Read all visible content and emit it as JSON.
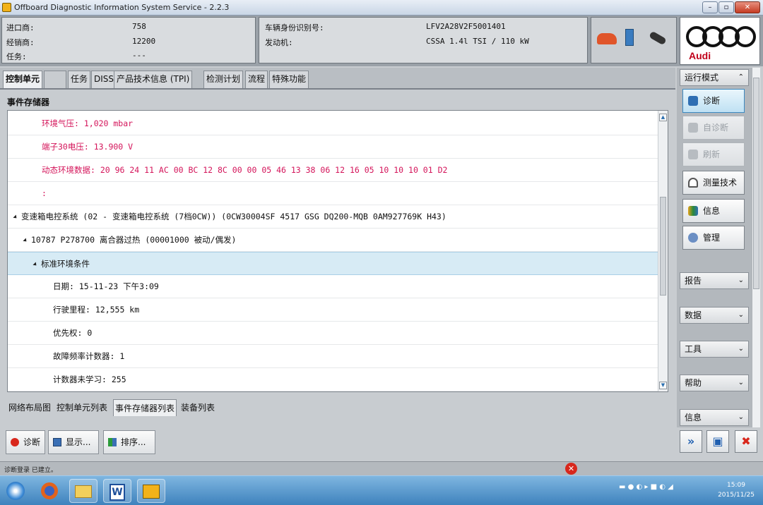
{
  "window": {
    "title": "Offboard Diagnostic Information System Service - 2.2.3"
  },
  "header": {
    "importer_label": "进口商:",
    "importer_value": "758",
    "dealer_label": "经销商:",
    "dealer_value": "12200",
    "task_label": "任务:",
    "task_value": "---",
    "vin_label": "车辆身份识别号:",
    "vin_value": "LFV2A28V2F5001401",
    "engine_label": "发动机:",
    "engine_value": "CSSA 1.4l TSI / 110 kW",
    "brand": "Audi"
  },
  "tabs": [
    {
      "label": "控制单元"
    },
    {
      "label": "   "
    },
    {
      "label": "任务"
    },
    {
      "label": "DISS"
    },
    {
      "label": "产品技术信息 (TPI)"
    },
    {
      "label": "检测计划"
    },
    {
      "label": "流程"
    },
    {
      "label": "特殊功能"
    }
  ],
  "content": {
    "title": "事件存储器",
    "rows": [
      {
        "text": "环境气压: 1,020 mbar"
      },
      {
        "text": "端子30电压: 13.900 V"
      },
      {
        "text": "动态环境数据: 20 96 24 11 AC 00 BC 12 8C 00 00 05 46 13 38 06 12 16 05 10 10 10 01 D2"
      },
      {
        "text": ":"
      },
      {
        "text": "变速箱电控系统 (02 - 变速箱电控系统 (7档0CW)) (0CW30004SF    4517   GSG DQ200-MQB    0AM927769K    H43)"
      },
      {
        "text": "10787   P278700   离合器过热  (00001000    被动/偶发)"
      },
      {
        "text": "标准环境条件"
      },
      {
        "text": "日期: 15-11-23 下午3:09"
      },
      {
        "text": "行驶里程: 12,555 km"
      },
      {
        "text": "优先权: 0"
      },
      {
        "text": "故障频率计数器: 1"
      },
      {
        "text": "计数器未学习: 255"
      }
    ]
  },
  "list_tabs": [
    {
      "label": "网络布局图"
    },
    {
      "label": "控制单元列表"
    },
    {
      "label": "事件存储器列表"
    },
    {
      "label": "装备列表"
    }
  ],
  "actions": {
    "diagnose": "诊断",
    "display": "显示...",
    "sort": "排序..."
  },
  "sidebar": {
    "mode_header": "运行模式",
    "buttons": [
      {
        "label": "诊断"
      },
      {
        "label": "自诊断"
      },
      {
        "label": "刷新"
      },
      {
        "label": "测量技术"
      },
      {
        "label": "信息"
      },
      {
        "label": "管理"
      }
    ],
    "sections": [
      {
        "label": "报告"
      },
      {
        "label": "数据"
      },
      {
        "label": "工具"
      },
      {
        "label": "帮助"
      },
      {
        "label": "信息"
      }
    ]
  },
  "statusbar": {
    "text": "诊断登录 已建立。"
  },
  "taskbar": {
    "time": "15:09",
    "date": "2015/11/25"
  },
  "colors": {
    "error_text": "#d4145a",
    "selection": "#d7ebf5",
    "brand_red": "#c0001a"
  }
}
